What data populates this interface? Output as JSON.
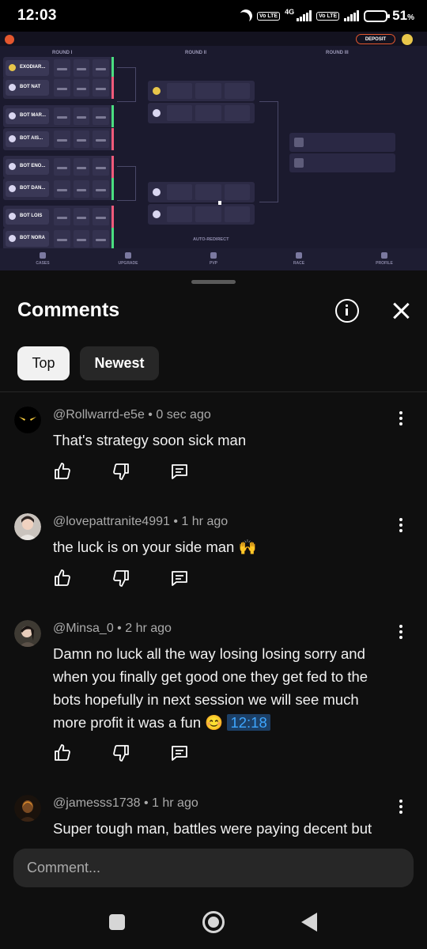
{
  "status_bar": {
    "time": "12:03",
    "network": "4G",
    "volte_1": "Vo LTE",
    "volte_2": "Vo LTE",
    "battery_percent": "51",
    "battery_unit": "%"
  },
  "video": {
    "deposit_label": "DEPOSIT",
    "round_1": "ROUND I",
    "round_2": "ROUND II",
    "round_3": "ROUND III",
    "auto_redirect": "AUTO-REDIRECT",
    "players": [
      "EXODIAR...",
      "BOT NAT",
      "BOT MAR...",
      "BOT AIS...",
      "BOT ENO...",
      "BOT DAN...",
      "BOT LOIS",
      "BOT NORA"
    ],
    "nav": [
      "CASES",
      "UPGRADE",
      "PVP",
      "RACE",
      "PROFILE"
    ]
  },
  "sheet": {
    "title": "Comments",
    "tabs": {
      "top": "Top",
      "newest": "Newest"
    }
  },
  "comments": [
    {
      "handle": "@Rollwarrd-e5e",
      "age": "0 sec ago",
      "text": "That's strategy soon sick man",
      "timestamp": ""
    },
    {
      "handle": "@lovepattranite4991",
      "age": "1 hr ago",
      "text": "the luck is on your side man 🙌",
      "timestamp": ""
    },
    {
      "handle": "@Minsa_0",
      "age": "2 hr ago",
      "text": "Damn no luck all the way losing losing sorry and when you finally get good one they get fed to the bots  hopefully in next session we will see much more profit it was a fun 😊",
      "timestamp": "12:18"
    },
    {
      "handle": "@jamesss1738",
      "age": "1 hr ago",
      "text": "Super tough man, battles were paying decent but",
      "timestamp": ""
    }
  ],
  "input": {
    "placeholder": "Comment..."
  },
  "separator": "•"
}
